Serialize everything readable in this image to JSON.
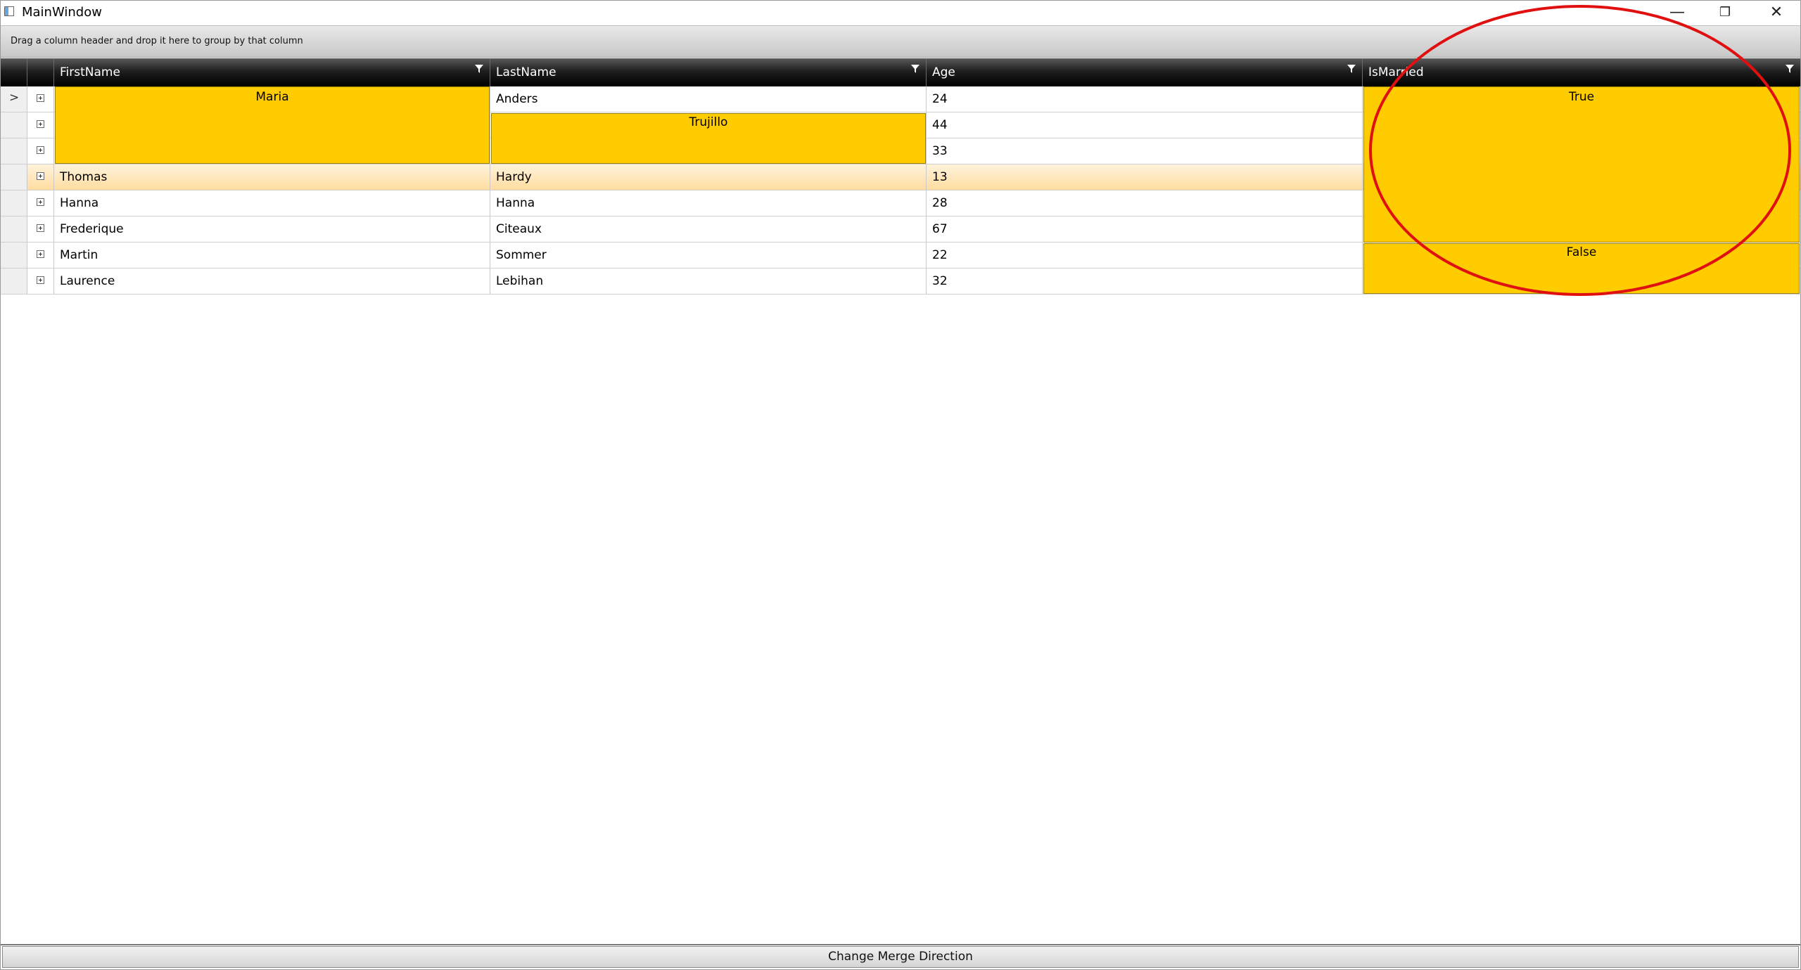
{
  "window": {
    "title": "MainWindow",
    "controls": {
      "minimize": "—",
      "restore": "❐",
      "close": "✕"
    }
  },
  "group_panel": {
    "text": "Drag a column header and drop it here to group by that column"
  },
  "columns": [
    "FirstName",
    "LastName",
    "Age",
    "IsMarried"
  ],
  "rows": [
    {
      "first": "",
      "last": "Anders",
      "age": "24"
    },
    {
      "first": "",
      "last": "",
      "age": "44"
    },
    {
      "first": "",
      "last": "",
      "age": "33"
    },
    {
      "first": "Thomas",
      "last": "Hardy",
      "age": "13"
    },
    {
      "first": "Hanna",
      "last": "Hanna",
      "age": "28"
    },
    {
      "first": "Frederique",
      "last": "Citeaux",
      "age": "67"
    },
    {
      "first": "Martin",
      "last": "Sommer",
      "age": "22"
    },
    {
      "first": "Laurence",
      "last": "Lebihan",
      "age": "32"
    }
  ],
  "merged": {
    "first_maria": "Maria",
    "last_trujillo": "Trujillo",
    "married_true": "True",
    "married_false": "False"
  },
  "current_row_indicator": ">",
  "button": {
    "label": "Change Merge Direction"
  },
  "colors": {
    "merge_fill": "#ffcc00",
    "annotation": "#e01010",
    "selected_row": "#ffdca0"
  }
}
